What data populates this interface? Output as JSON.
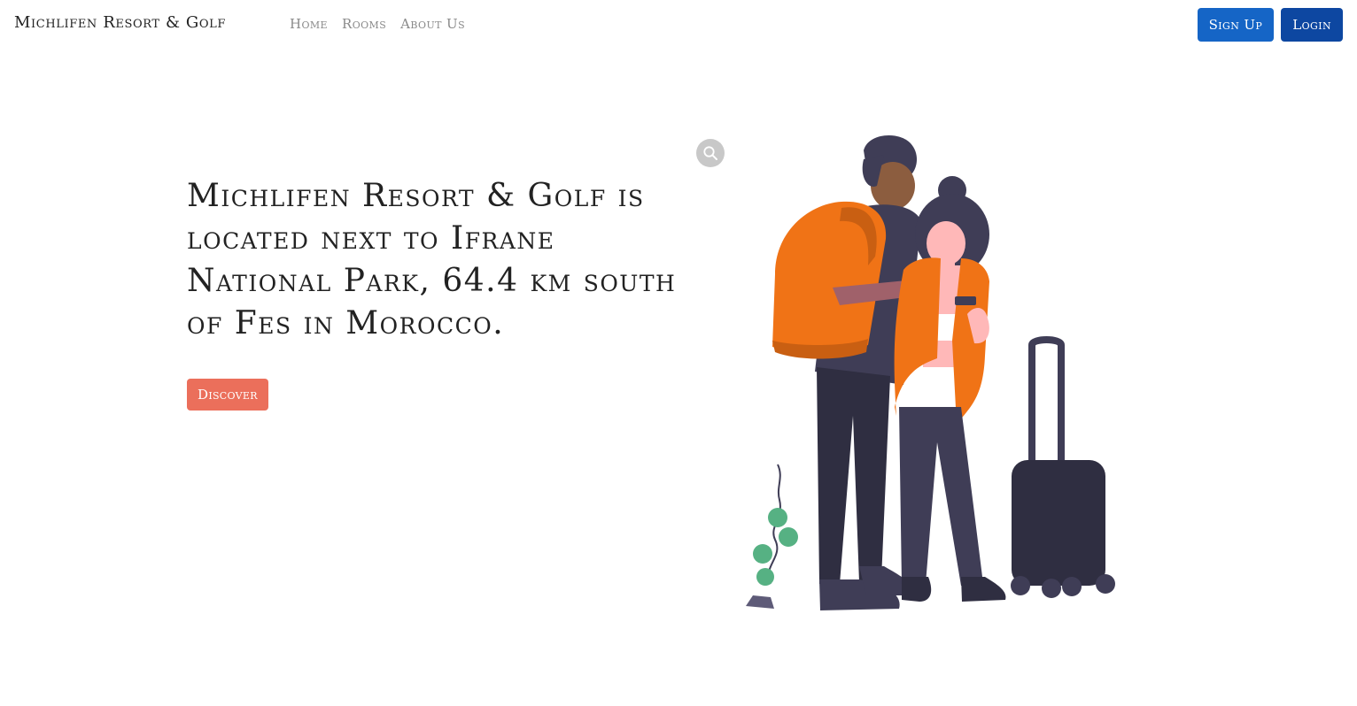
{
  "navbar": {
    "brand": "Michlifen Resort & Golf",
    "links": [
      "Home",
      "Rooms",
      "About Us"
    ],
    "signup_label": "Sign Up",
    "login_label": "Login"
  },
  "hero": {
    "headline": "Michlifen Resort & Golf is located next to Ifrane National Park, 64.4 km south of Fes in Morocco.",
    "cta_label": "Discover"
  },
  "icons": {
    "zoom": "search-icon",
    "illustration": "travelers-illustration"
  },
  "colors": {
    "signup": "#1565c6",
    "login": "#0d47a1",
    "discover": "#eb6f5b",
    "accent_orange": "#f07316",
    "dark_figure": "#3f3d56"
  }
}
